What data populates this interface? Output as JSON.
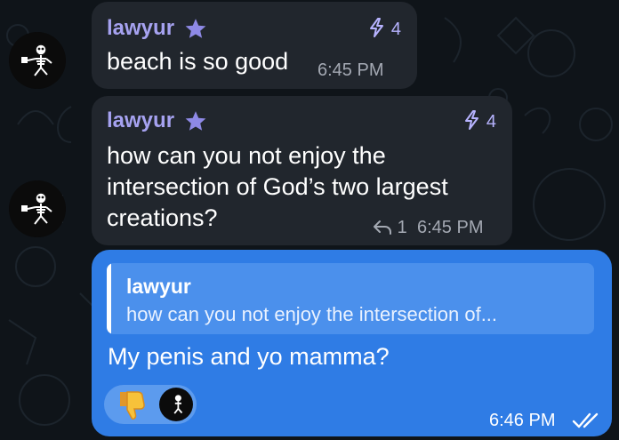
{
  "messages": [
    {
      "sender": "lawyur",
      "boost_count": "4",
      "text": "beach is so good",
      "time": "6:45 PM"
    },
    {
      "sender": "lawyur",
      "boost_count": "4",
      "text": "how can you not enjoy the intersection of God’s two largest creations?",
      "reply_count": "1",
      "time": "6:45 PM"
    }
  ],
  "outgoing": {
    "quote_sender": "lawyur",
    "quote_text": "how can you not enjoy the intersection of...",
    "text": "My penis and yo mamma?",
    "reaction_emoji": "thumbs-down",
    "time": "6:46 PM",
    "status": "read-double-check"
  },
  "colors": {
    "background": "#0f1419",
    "incoming_bubble": "#21262d",
    "sender_name": "#a6a2f0",
    "outgoing_bubble": "#2f7ce5"
  }
}
